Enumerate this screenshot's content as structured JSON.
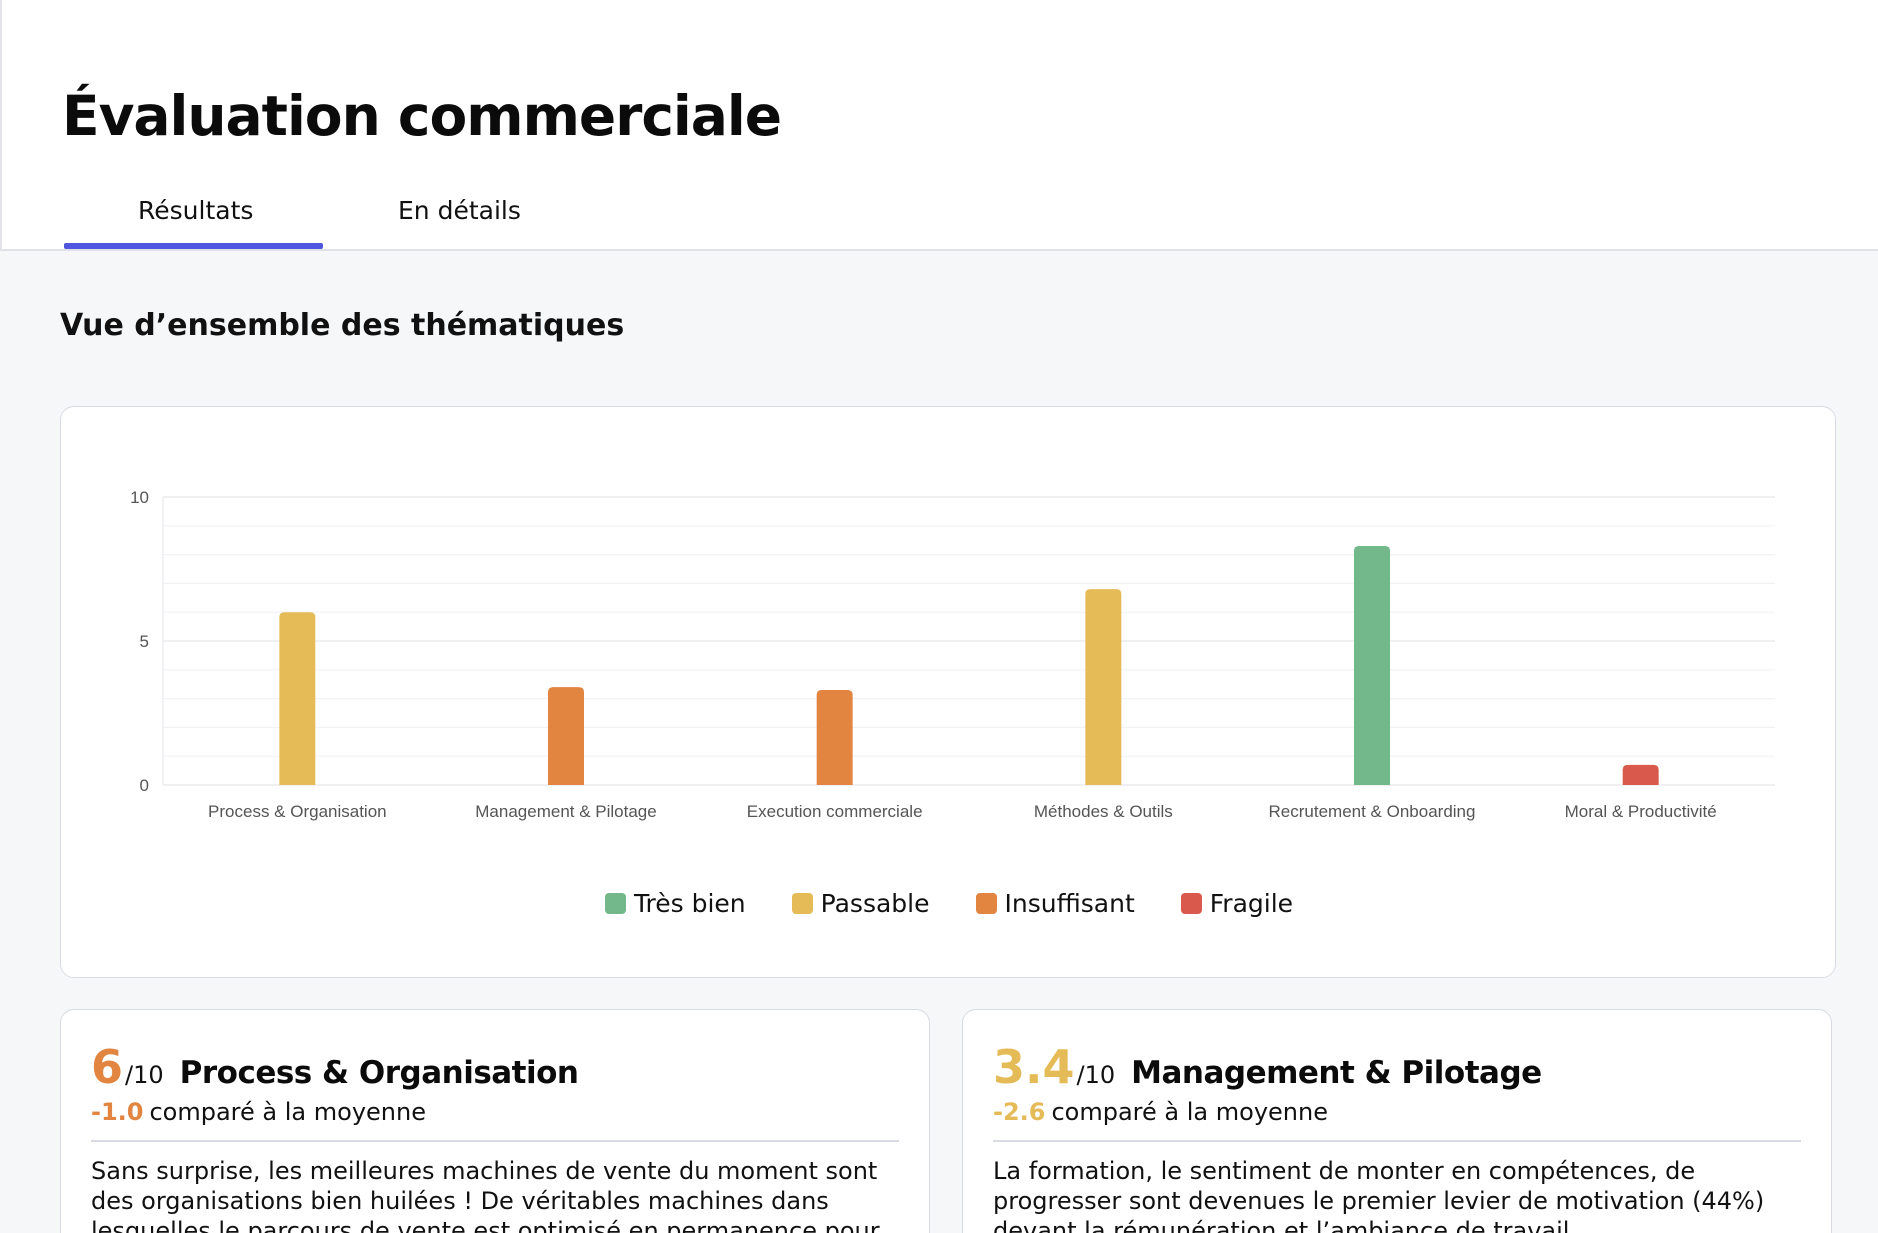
{
  "header": {
    "title": "Évaluation commerciale",
    "tabs": [
      {
        "label": "Résultats",
        "active": true
      },
      {
        "label": "En détails",
        "active": false
      }
    ],
    "accent": "#4f56e0"
  },
  "overview": {
    "title": "Vue d’ensemble des thématiques"
  },
  "colors": {
    "tres_bien": "#73b88b",
    "passable": "#e5bb58",
    "insuffisant": "#e28541",
    "fragile": "#d95a4d"
  },
  "chart_data": {
    "type": "bar",
    "categories": [
      "Process & Organisation",
      "Management & Pilotage",
      "Execution commerciale",
      "Méthodes & Outils",
      "Recrutement & Onboarding",
      "Moral & Productivité"
    ],
    "values": [
      6.0,
      3.4,
      3.3,
      6.8,
      8.3,
      0.7
    ],
    "bar_colors": [
      "#e5bb58",
      "#e28541",
      "#e28541",
      "#e5bb58",
      "#73b88b",
      "#d95a4d"
    ],
    "ylim": [
      0,
      10
    ],
    "yticks": [
      0,
      5,
      10
    ],
    "grid": true,
    "legend": [
      {
        "label": "Très bien",
        "color": "#73b88b"
      },
      {
        "label": "Passable",
        "color": "#e5bb58"
      },
      {
        "label": "Insuffisant",
        "color": "#e28541"
      },
      {
        "label": "Fragile",
        "color": "#d95a4d"
      }
    ],
    "legend_position": "bottom-center"
  },
  "cards": [
    {
      "score": "6",
      "max": "/10",
      "title": "Process & Organisation",
      "delta": "-1.0",
      "compare": "comparé à la moyenne",
      "score_color": "#e28541",
      "text": "Sans surprise, les meilleures machines de vente du moment sont des organisations bien huilées ! De véritables machines dans lesquelles le parcours de vente est optimisé en permanence pour ne laisser aucune"
    },
    {
      "score": "3.4",
      "max": "/10",
      "title": "Management & Pilotage",
      "delta": "-2.6",
      "compare": "comparé à la moyenne",
      "score_color": "#e5bb58",
      "text": "La formation, le sentiment de monter en compétences, de progresser sont devenues le premier levier de motivation (44%) devant la rémunération et l’ambiance de travail"
    }
  ]
}
